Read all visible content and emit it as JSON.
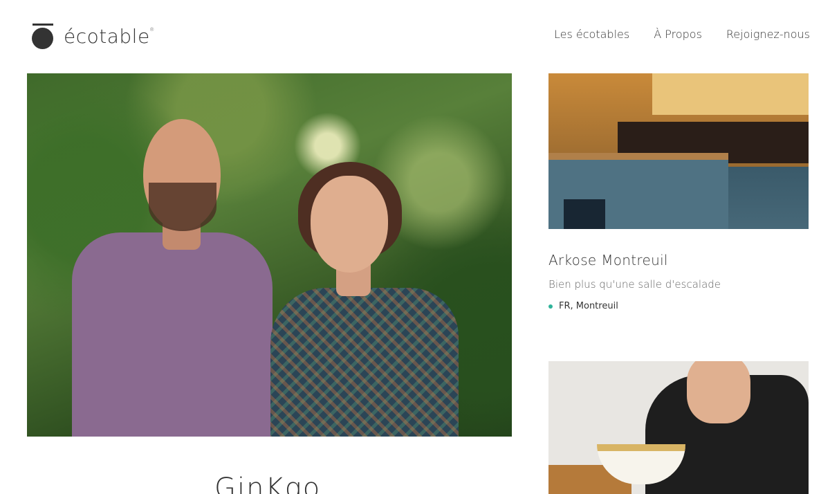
{
  "brand": {
    "name": "écotable",
    "reg": "®"
  },
  "nav": [
    {
      "label": "Les écotables"
    },
    {
      "label": "À Propos"
    },
    {
      "label": "Rejoignez-nous"
    }
  ],
  "cards": [
    {
      "title": "Arkose Montreuil",
      "subtitle": "Bien plus qu'une salle d'escalade",
      "location": "FR, Montreuil",
      "accent": "#2fb39a"
    }
  ],
  "featured": {
    "title_partial": "GinKgo"
  }
}
